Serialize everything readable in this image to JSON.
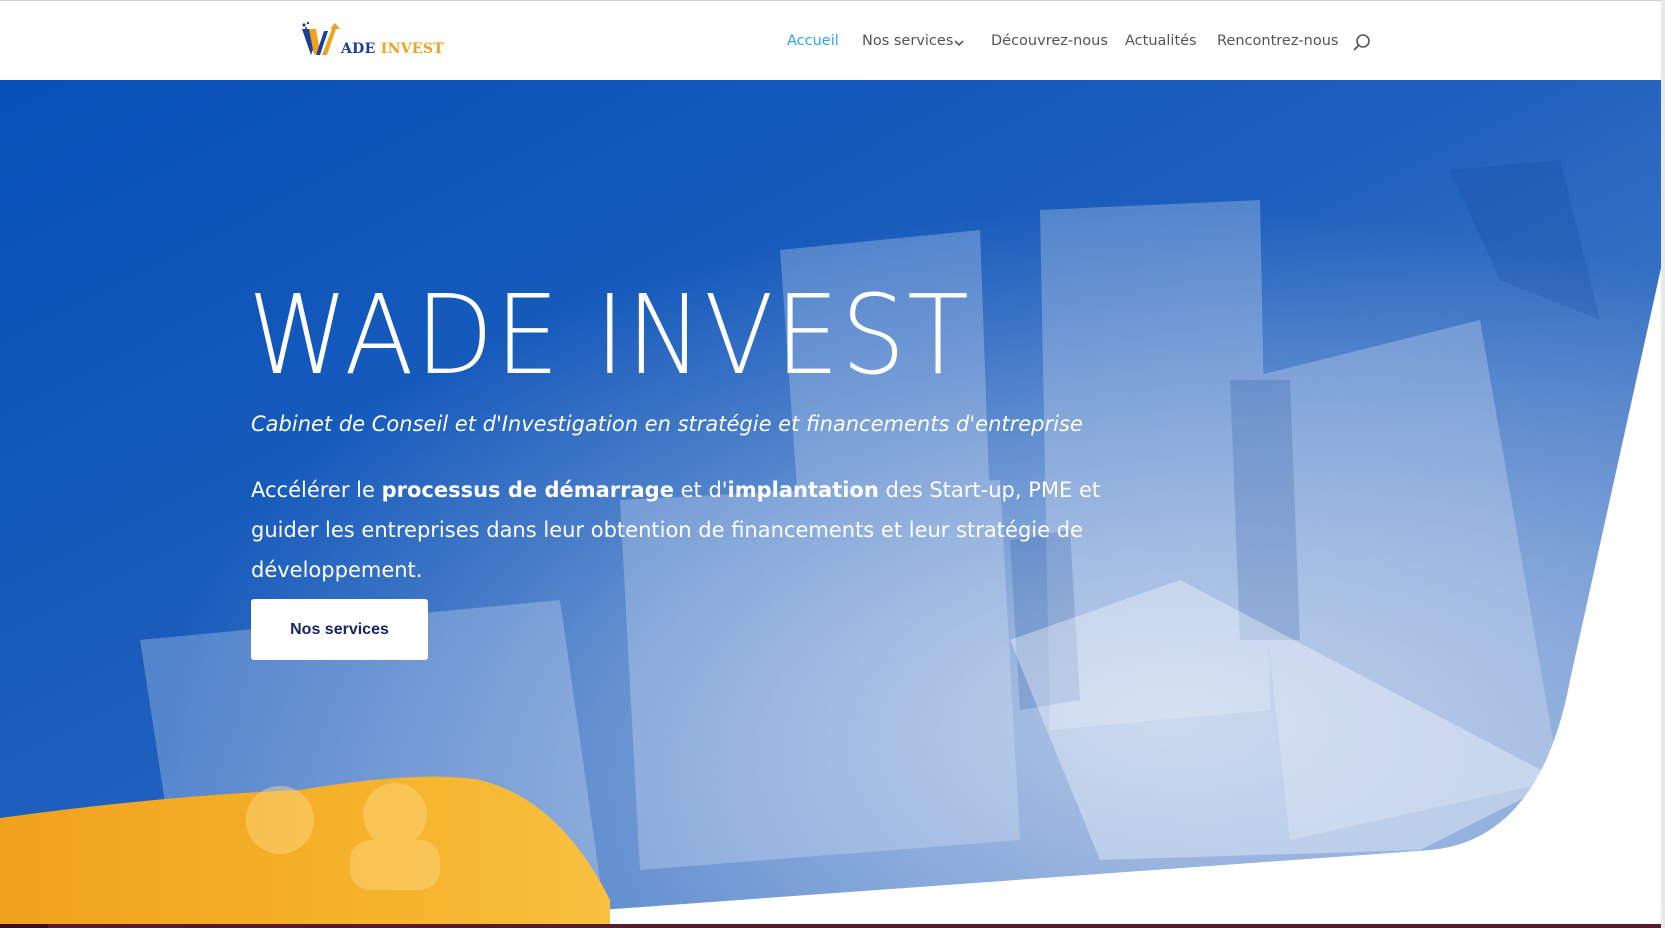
{
  "brand": {
    "logo_text_1": "ADE",
    "logo_text_2": "INVEST",
    "accent_color": "#f0a21d",
    "primary_color": "#1b3f94"
  },
  "nav": {
    "items": [
      {
        "label": "Accueil",
        "active": true
      },
      {
        "label": "Nos services",
        "has_dropdown": true
      },
      {
        "label": "Découvrez-nous"
      },
      {
        "label": "Actualités"
      },
      {
        "label": "Rencontrez-nous"
      }
    ],
    "search_icon": "search-icon",
    "active_color": "#2ea3f2"
  },
  "hero": {
    "title": "WADE INVEST",
    "subtitle": "Cabinet de Conseil et d'Investigation en stratégie et financements d'entreprise",
    "desc_1": "Accélérer le ",
    "desc_bold_1": "processus de démarrage",
    "desc_2": " et d'",
    "desc_bold_2": "implantation",
    "desc_3": " des Start-up, PME et guider les entreprises dans leur obtention de financements et leur stratégie de  développement.",
    "button_label": "Nos services",
    "bg_color": "#0a52b5"
  }
}
